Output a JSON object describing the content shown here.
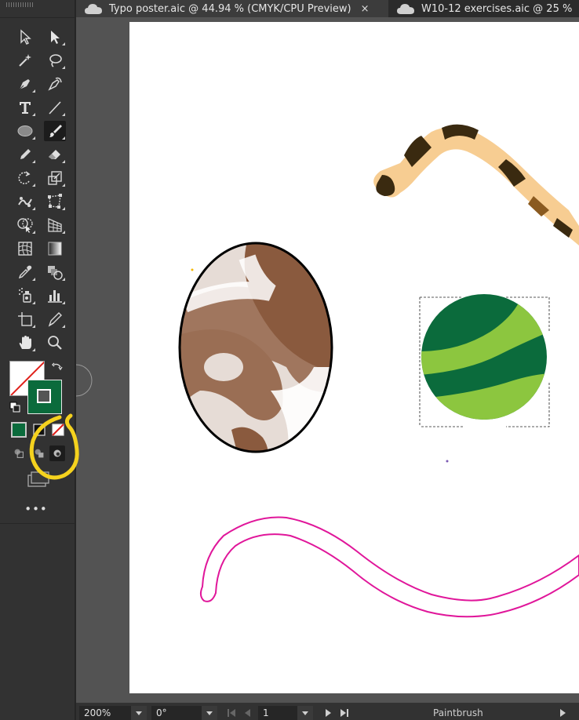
{
  "tabs": [
    {
      "title": "Typo poster.aic @ 44.94 % (CMYK/CPU Preview)",
      "close": "×",
      "active": true
    },
    {
      "title": "W10-12 exercises.aic @ 25 %",
      "active": false
    }
  ],
  "colors": {
    "fill": "none",
    "stroke": "#0b6b3c",
    "accent_annotation": "#f5d21e"
  },
  "toolbar": {
    "more_label": "•••",
    "tools": [
      "selection-tool",
      "direct-selection-tool",
      "magic-wand-tool",
      "lasso-tool",
      "pen-tool",
      "curvature-tool",
      "type-tool",
      "line-segment-tool",
      "ellipse-tool",
      "paintbrush-tool",
      "pencil-tool",
      "eraser-tool",
      "rotate-tool",
      "scale-tool",
      "puppet-warp-tool",
      "free-transform-tool",
      "shape-builder-tool",
      "perspective-grid-tool",
      "mesh-tool",
      "gradient-tool",
      "eyedropper-tool",
      "blend-tool",
      "symbol-sprayer-tool",
      "column-graph-tool",
      "artboard-tool",
      "slice-tool",
      "hand-tool",
      "zoom-tool"
    ],
    "active_tool": "paintbrush-tool"
  },
  "status": {
    "zoom": "200%",
    "rotation": "0°",
    "artboard_number": "1",
    "current_tool": "Paintbrush"
  }
}
